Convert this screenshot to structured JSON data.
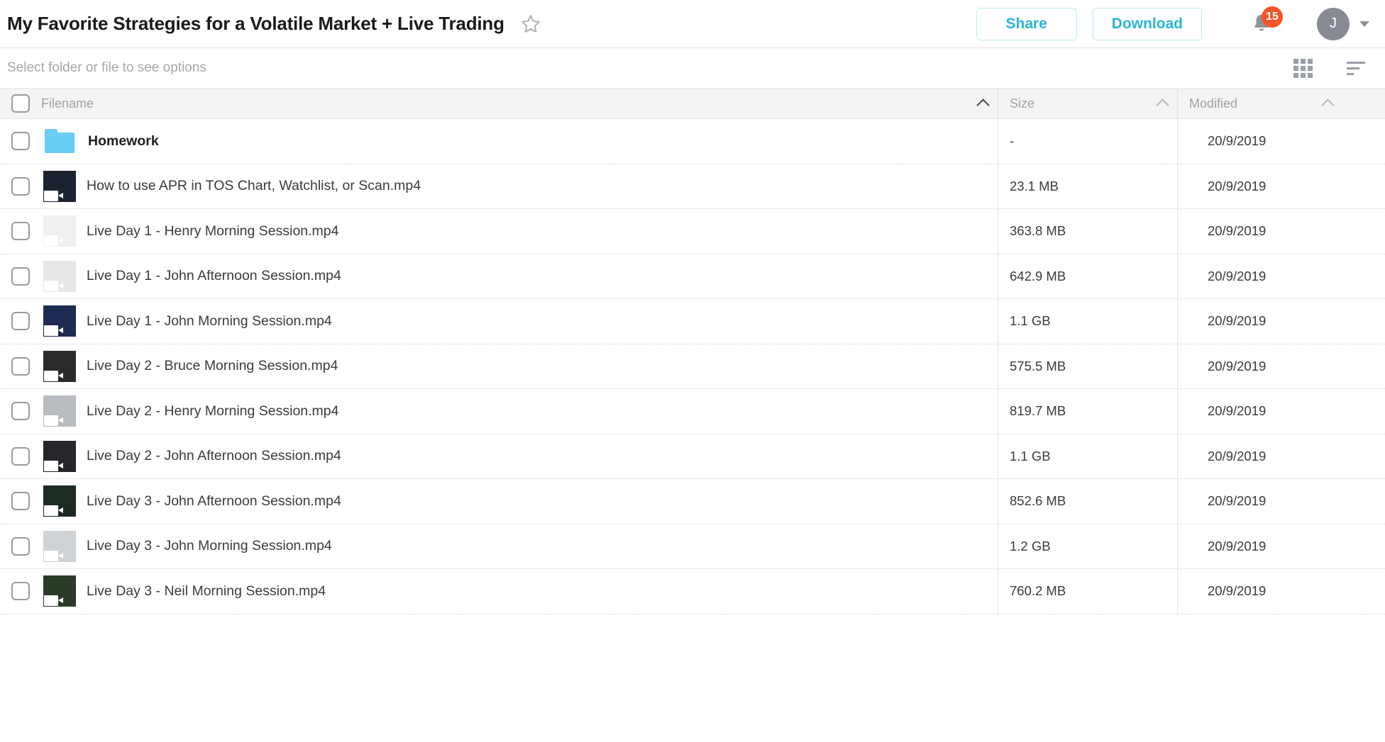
{
  "header": {
    "title": "My Favorite Strategies for a Volatile Market + Live Trading",
    "star_icon": "star-outline-icon",
    "share_label": "Share",
    "download_label": "Download",
    "bell_icon": "bell-icon",
    "notification_count": "15",
    "avatar_initial": "J",
    "accent_color": "#29b6d8",
    "badge_color": "#f4552a"
  },
  "optionbar": {
    "hint": "Select folder or file to see options",
    "grid_icon": "grid-view-icon",
    "sort_icon": "sort-list-icon"
  },
  "table": {
    "columns": {
      "filename": "Filename",
      "size": "Size",
      "modified": "Modified"
    },
    "sort": {
      "active_column": "filename",
      "direction": "asc"
    },
    "rows": [
      {
        "name": "Homework",
        "type": "folder",
        "size": "-",
        "modified": "20/9/2019"
      },
      {
        "name": "How to use APR in TOS Chart, Watchlist, or Scan.mp4",
        "type": "video",
        "size": "23.1 MB",
        "modified": "20/9/2019"
      },
      {
        "name": "Live Day 1 - Henry Morning Session.mp4",
        "type": "video",
        "size": "363.8 MB",
        "modified": "20/9/2019"
      },
      {
        "name": "Live Day 1 - John Afternoon Session.mp4",
        "type": "video",
        "size": "642.9 MB",
        "modified": "20/9/2019"
      },
      {
        "name": "Live Day 1 - John Morning Session.mp4",
        "type": "video",
        "size": "1.1 GB",
        "modified": "20/9/2019"
      },
      {
        "name": "Live Day 2 - Bruce Morning Session.mp4",
        "type": "video",
        "size": "575.5 MB",
        "modified": "20/9/2019"
      },
      {
        "name": "Live Day 2 - Henry Morning Session.mp4",
        "type": "video",
        "size": "819.7 MB",
        "modified": "20/9/2019"
      },
      {
        "name": "Live Day 2 - John Afternoon Session.mp4",
        "type": "video",
        "size": "1.1 GB",
        "modified": "20/9/2019"
      },
      {
        "name": "Live Day 3 - John Afternoon Session.mp4",
        "type": "video",
        "size": "852.6 MB",
        "modified": "20/9/2019"
      },
      {
        "name": "Live Day 3 - John Morning Session.mp4",
        "type": "video",
        "size": "1.2 GB",
        "modified": "20/9/2019"
      },
      {
        "name": "Live Day 3 - Neil Morning Session.mp4",
        "type": "video",
        "size": "760.2 MB",
        "modified": "20/9/2019"
      }
    ],
    "thumbnail_colors": [
      "",
      "#1b2230",
      "#f0f0f0",
      "#e8e8e8",
      "#1d2a52",
      "#2a2a2a",
      "#b9bcc0",
      "#24262b",
      "#1e2b22",
      "#cfd3d6",
      "#2c3a2a"
    ]
  }
}
